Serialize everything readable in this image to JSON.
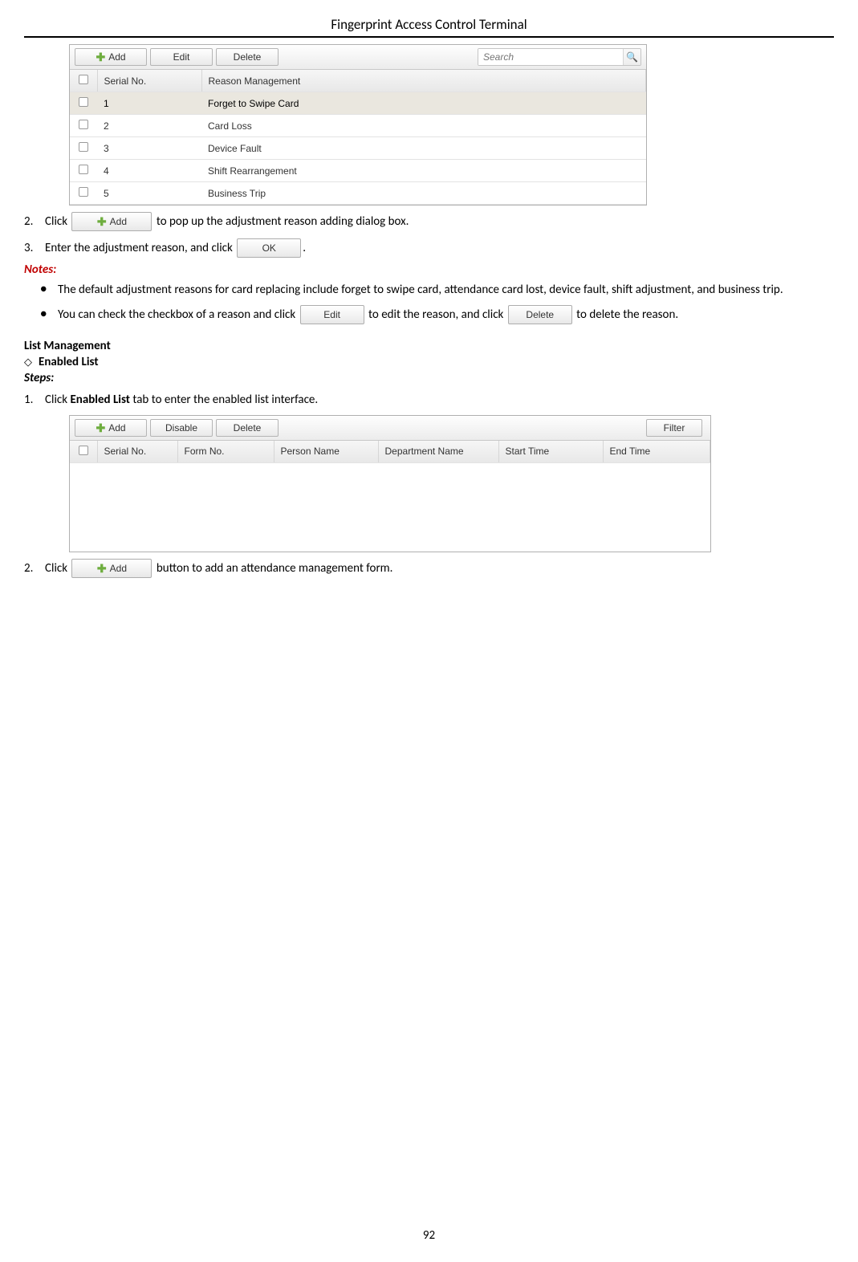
{
  "doc": {
    "header": "Fingerprint Access Control Terminal",
    "page_number": "92"
  },
  "panel1": {
    "buttons": {
      "add": "Add",
      "edit": "Edit",
      "delete": "Delete"
    },
    "search_placeholder": "Search",
    "columns": {
      "serial": "Serial No.",
      "reason": "Reason Management"
    },
    "rows": [
      {
        "serial": "1",
        "reason": "Forget to Swipe Card",
        "selected": true
      },
      {
        "serial": "2",
        "reason": "Card Loss",
        "selected": false
      },
      {
        "serial": "3",
        "reason": "Device Fault",
        "selected": false
      },
      {
        "serial": "4",
        "reason": "Shift Rearrangement",
        "selected": false
      },
      {
        "serial": "5",
        "reason": "Business Trip",
        "selected": false
      }
    ]
  },
  "steps1": {
    "s2_pre": "Click",
    "s2_post": "to pop up the adjustment reason adding dialog box.",
    "s3_pre": "Enter the adjustment reason, and click",
    "s3_post": "."
  },
  "chips": {
    "add": "Add",
    "ok": "OK",
    "edit": "Edit",
    "delete": "Delete"
  },
  "notes": {
    "label": "Notes:",
    "b1": "The default adjustment reasons for card replacing include forget to swipe card, attendance card lost, device fault, shift adjustment, and business trip.",
    "b2_a": "You can check the checkbox of a reason and click",
    "b2_b": "to edit the reason, and click",
    "b2_c": "to delete the reason."
  },
  "section2": {
    "title": "List Management",
    "sub": "Enabled List",
    "steps_label": "Steps:",
    "s1_pre": "Click",
    "s1_bold": "Enabled List",
    "s1_post": "tab to enter the enabled list interface.",
    "s2_pre": "Click",
    "s2_post": "button to add an attendance management form."
  },
  "panel2": {
    "buttons": {
      "add": "Add",
      "disable": "Disable",
      "delete": "Delete",
      "filter": "Filter"
    },
    "columns": {
      "serial": "Serial No.",
      "form": "Form No.",
      "person": "Person Name",
      "dept": "Department Name",
      "start": "Start Time",
      "end": "End Time"
    }
  }
}
